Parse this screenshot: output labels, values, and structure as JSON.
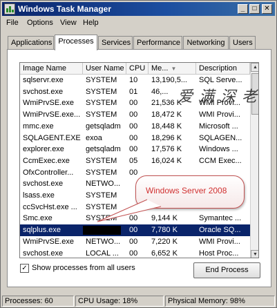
{
  "window": {
    "title": "Windows Task Manager",
    "caption_buttons": {
      "minimize": "_",
      "maximize": "□",
      "close": "✕"
    }
  },
  "menu": [
    "File",
    "Options",
    "View",
    "Help"
  ],
  "tabs": [
    {
      "label": "Applications",
      "active": false
    },
    {
      "label": "Processes",
      "active": true
    },
    {
      "label": "Services",
      "active": false
    },
    {
      "label": "Performance",
      "active": false
    },
    {
      "label": "Networking",
      "active": false
    },
    {
      "label": "Users",
      "active": false
    }
  ],
  "table": {
    "columns": [
      "Image Name",
      "User Name",
      "CPU",
      "Me...",
      "Description"
    ],
    "sort_indicator": "▼",
    "rows": [
      {
        "image": "sqlservr.exe",
        "user": "SYSTEM",
        "cpu": "10",
        "mem": "13,190,5...",
        "desc": "SQL Serve..."
      },
      {
        "image": "svchost.exe",
        "user": "SYSTEM",
        "cpu": "01",
        "mem": "46,...",
        "desc": ""
      },
      {
        "image": "WmiPrvSE.exe",
        "user": "SYSTEM",
        "cpu": "00",
        "mem": "21,536 K",
        "desc": "WMI Provi..."
      },
      {
        "image": "WmiPrvSE.exe...",
        "user": "SYSTEM",
        "cpu": "00",
        "mem": "18,472 K",
        "desc": "WMI Provi..."
      },
      {
        "image": "mmc.exe",
        "user": "getsqladm",
        "cpu": "00",
        "mem": "18,448 K",
        "desc": "Microsoft ..."
      },
      {
        "image": "SQLAGENT.EXE",
        "user": "exoa",
        "cpu": "00",
        "mem": "18,296 K",
        "desc": "SQLAGEN..."
      },
      {
        "image": "explorer.exe",
        "user": "getsqladm",
        "cpu": "00",
        "mem": "17,576 K",
        "desc": "Windows ..."
      },
      {
        "image": "CcmExec.exe",
        "user": "SYSTEM",
        "cpu": "05",
        "mem": "16,024 K",
        "desc": "CCM Exec..."
      },
      {
        "image": "OfxController...",
        "user": "SYSTEM",
        "cpu": "00",
        "mem": "",
        "desc": ""
      },
      {
        "image": "svchost.exe",
        "user": "NETWO...",
        "cpu": "",
        "mem": "",
        "desc": ""
      },
      {
        "image": "lsass.exe",
        "user": "SYSTEM",
        "cpu": "",
        "mem": "",
        "desc": ""
      },
      {
        "image": "ccSvcHst.exe ...",
        "user": "SYSTEM",
        "cpu": "",
        "mem": "",
        "desc": ""
      },
      {
        "image": "Smc.exe",
        "user": "SYSTEM",
        "cpu": "00",
        "mem": "9,144 K",
        "desc": "Symantec ..."
      },
      {
        "image": "sqlplus.exe",
        "user": "",
        "cpu": "00",
        "mem": "7,780 K",
        "desc": "Oracle SQ...",
        "selected": true,
        "redacted": true
      },
      {
        "image": "WmiPrvSE.exe",
        "user": "NETWO...",
        "cpu": "00",
        "mem": "7,220 K",
        "desc": "WMI Provi..."
      },
      {
        "image": "svchost.exe",
        "user": "LOCAL ...",
        "cpu": "00",
        "mem": "6,652 K",
        "desc": "Host Proc..."
      }
    ]
  },
  "callout": {
    "text": "Windows Server 2008"
  },
  "watermark": {
    "text": "爱 满 深 老"
  },
  "show_all_processes": {
    "label": "Show processes from all users",
    "checked": true,
    "mark": "✓"
  },
  "end_process_button": "End Process",
  "status": {
    "processes": "Processes: 60",
    "cpu_usage": "CPU Usage: 18%",
    "physical_memory": "Physical Memory: 98%"
  },
  "scrollbar": {
    "up": "▲",
    "down": "▼"
  }
}
